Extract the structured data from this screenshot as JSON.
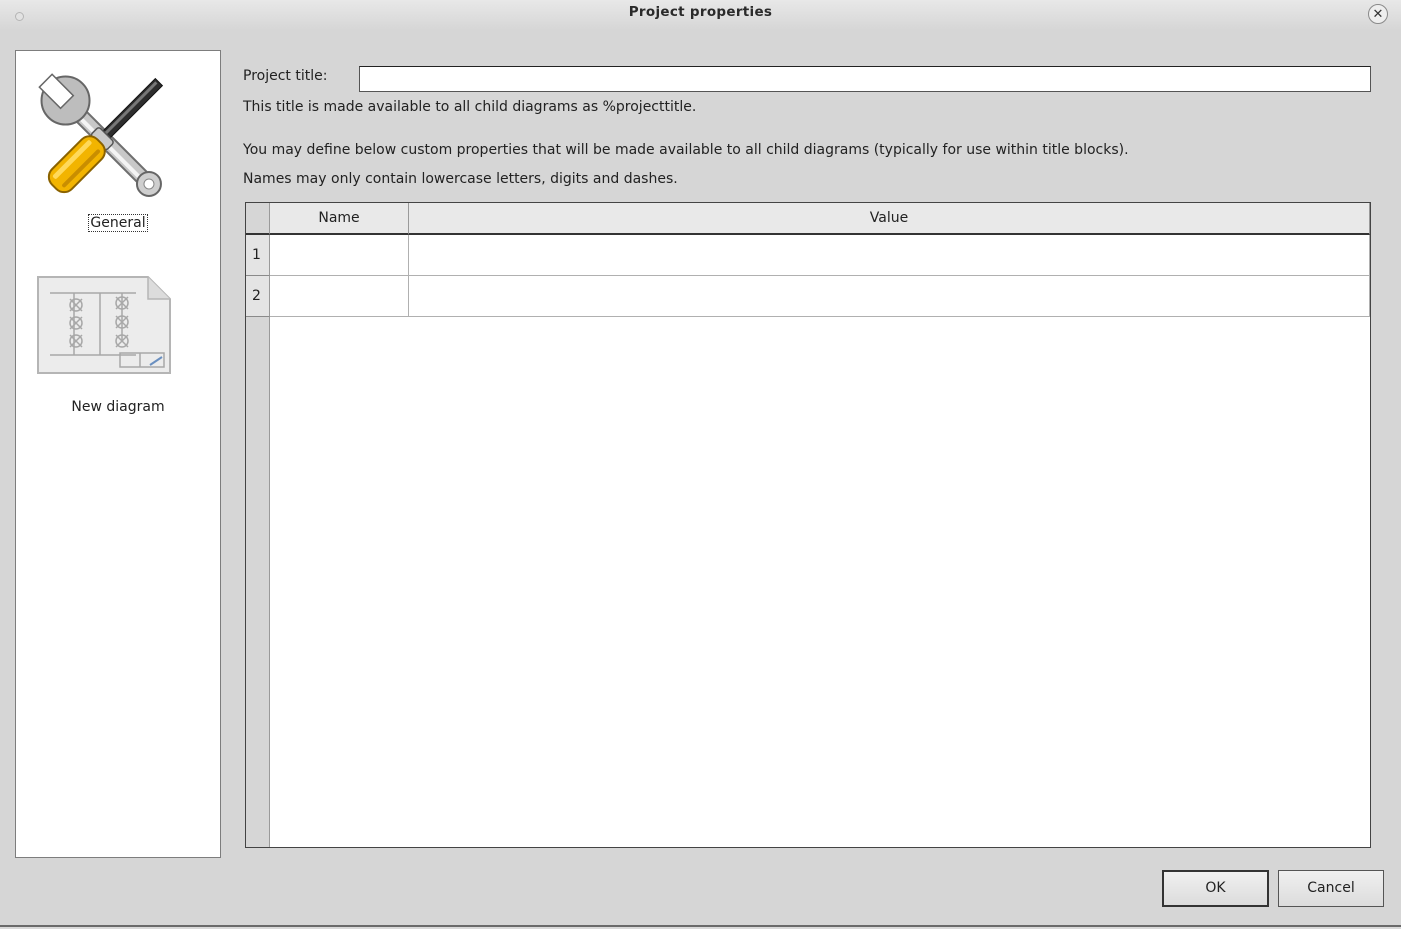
{
  "window": {
    "title": "Project properties",
    "close_symbol": "✕"
  },
  "sidebar": {
    "items": [
      {
        "label": "General",
        "icon": "tools-icon",
        "selected": true
      },
      {
        "label": "New diagram",
        "icon": "diagram-icon",
        "selected": false
      }
    ]
  },
  "general": {
    "project_title_label": "Project title:",
    "project_title_value": "",
    "title_info": "This title is made available to all child diagrams as %projecttitle.",
    "custom_info_line1": "You may define below custom properties that will be made available to all child diagrams (typically for use within title blocks).",
    "custom_info_line2": "Names may only contain lowercase letters, digits and dashes."
  },
  "table": {
    "columns": [
      "Name",
      "Value"
    ],
    "rows": [
      {
        "index": "1",
        "name": "",
        "value": ""
      },
      {
        "index": "2",
        "name": "",
        "value": ""
      }
    ]
  },
  "buttons": {
    "ok": "OK",
    "cancel": "Cancel"
  }
}
